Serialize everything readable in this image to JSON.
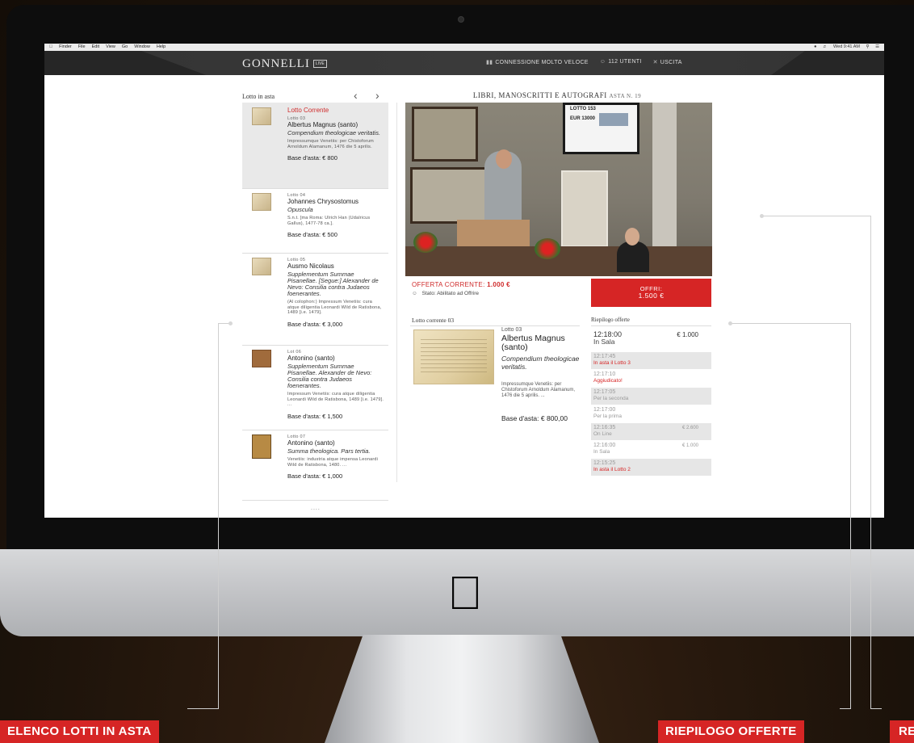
{
  "menubar": {
    "items": [
      "Finder",
      "File",
      "Edit",
      "View",
      "Go",
      "Window",
      "Help"
    ],
    "clock": "Wed 9:41 AM"
  },
  "header": {
    "brand": "GONNELLI",
    "brand_badge": "LIVE",
    "connection": "CONNESSIONE MOLTO VELOCE",
    "users": "112 UTENTI",
    "exit": "USCITA"
  },
  "lots": {
    "heading": "Lotto in asta",
    "items": [
      {
        "flag": "Lotto Corrente",
        "num": "Lotto 03",
        "author": "Albertus Magnus (santo)",
        "title": "Compendium theologicae veritatis.",
        "desc": "Impressumque Venetiis: per Chistoforum Arnoldum Alamanum, 1476 die 5 aprilis.",
        "base": "Base d'asta: € 800"
      },
      {
        "num": "Lotto 04",
        "author": "Johannes Chrysostomus",
        "title": "Opuscula",
        "desc": "S.n.t. [ma Roma: Ulrich Han (Udalricus Gallus), 1477-78 ca.].",
        "base": "Base d'asta: € 500"
      },
      {
        "num": "Lotto 05",
        "author": "Ausmo Nicolaus",
        "title": "Supplementum Summae Pisanellae. [Segue:] Alexander de Nevo: Consilia contra Judaeos foenerantes.",
        "desc": "(Al colophon:) Impressum Venetiis: cura atque diligentia Leonardi Wild de Ratisbona, 1489 [i.e. 1479].",
        "base": "Base d'asta: € 3,000"
      },
      {
        "num": "Lot 06",
        "author": "Antonino (santo)",
        "title": "Supplementum Summae Pisanellae. Alexander de Nevo: Consilia contra Judaeos foenerantes.",
        "desc": "Impressum Venetiis: cura atque diligentia Leonardi Wild de Ratisbona, 1489 [i.e. 1479]. ...",
        "base": "Base d'asta: € 1,500"
      },
      {
        "num": "Lotto 07",
        "author": "Antonino (santo)",
        "title": "Summa theologica. Pars tertia.",
        "desc": "Venetiis: industria atque impensa Leonardi Wild de Ratisbona, 1480. ...",
        "base": "Base d'asta: € 1,000"
      }
    ],
    "more": "...."
  },
  "main": {
    "auction_title": "LIBRI, MANOSCRITTI E AUTOGRAFI",
    "auction_number": "ASTA N. 19",
    "video": {
      "tv_lot": "LOTTO 153",
      "tv_eur": "EUR 13000"
    },
    "current_offer_label": "OFFERTA CORRENTE:",
    "current_offer_value": "1.000 €",
    "bid_state": "Stato: Abilitato ad Offrire",
    "offer_button_label": "OFFRI:",
    "offer_button_amount": "1.500 €"
  },
  "current_lot": {
    "heading": "Lotto corrente 03",
    "num": "Lotto 03",
    "author": "Albertus Magnus (santo)",
    "title": "Compendium theologicae veritatis.",
    "desc": "Impressumque Venetiis: per Chistoforum Arnoldum Alamanum, 1476 die 5 aprilis. ...",
    "base": "Base d'asta: € 800,00"
  },
  "offers": {
    "heading": "Riepilogo offerte",
    "rows": [
      {
        "time": "12:18:00",
        "note": "In Sala",
        "amount": "€ 1.000",
        "style": "big"
      },
      {
        "time": "12:17:45",
        "note": "In asta il Lotto 3",
        "amount": "",
        "style": "shaded-red"
      },
      {
        "time": "12:17:10",
        "note": "Aggiudicato!",
        "amount": "",
        "style": "red"
      },
      {
        "time": "12:17:05",
        "note": "Per la seconda",
        "amount": "",
        "style": "shaded"
      },
      {
        "time": "12:17:00",
        "note": "Per la prima",
        "amount": "",
        "style": "plain"
      },
      {
        "time": "12:16:35",
        "note": "On Line",
        "amount": "€ 2.600",
        "style": "shaded"
      },
      {
        "time": "12:16:00",
        "note": "In Sala",
        "amount": "€ 1.000",
        "style": "plain"
      },
      {
        "time": "12:15:25",
        "note": "In asta il Lotto 2",
        "amount": "",
        "style": "shaded-red"
      }
    ]
  },
  "callouts": {
    "lots": "ELENCO LOTTI IN ASTA",
    "offers": "RIEPILOGO OFFERTE",
    "video": "RE"
  },
  "colors": {
    "accent_red": "#d62525",
    "header_bg": "#333333"
  }
}
